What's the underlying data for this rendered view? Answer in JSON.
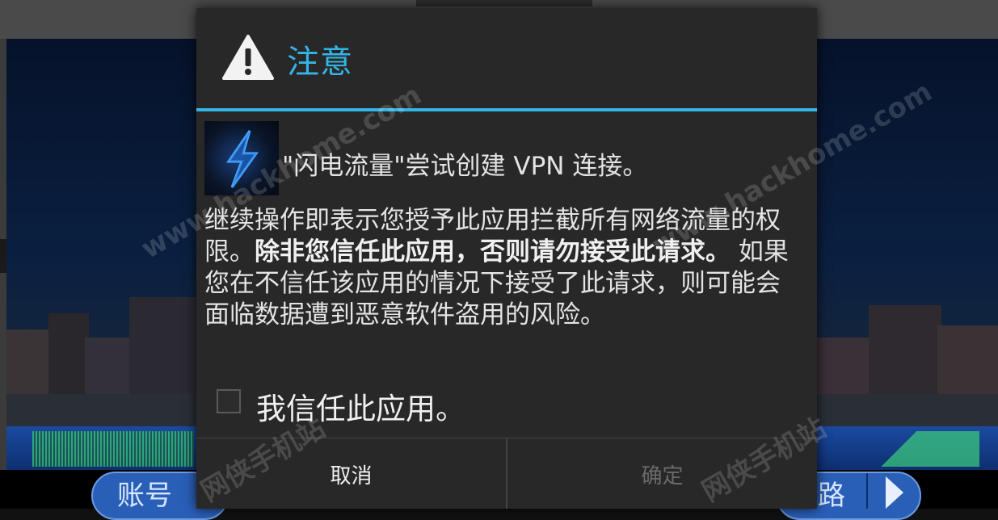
{
  "background": {
    "left_button_label": "账号",
    "right_button_label": "路"
  },
  "dialog": {
    "title": "注意",
    "title_icon": "warning-triangle-icon",
    "app_icon": "lightning-app-icon",
    "app_line": "\"闪电流量\"尝试创建 VPN 连接。",
    "body_intro": "继续操作即表示您授予此应用拦截所有网络流量的权限。",
    "body_warning": "除非您信任此应用，否则请勿接受此请求。",
    "body_rest": "如果您在不信任该应用的情况下接受了此请求，则可能会面临数据遭到恶意软件盗用的风险。",
    "checkbox_label": "我信任此应用。",
    "checkbox_checked": false,
    "cancel_label": "取消",
    "ok_label": "确定",
    "accent_color": "#33b5e5"
  },
  "watermarks": {
    "url": "www.hackhome.com",
    "site_name": "网侠手机站"
  }
}
